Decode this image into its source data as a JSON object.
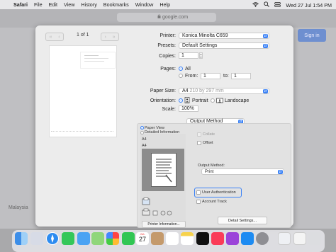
{
  "menubar": {
    "items": [
      "Safari",
      "File",
      "Edit",
      "View",
      "History",
      "Bookmarks",
      "Window",
      "Help"
    ],
    "datetime": "Wed 27 Jul  1:54 PM"
  },
  "browser": {
    "url": "google.com",
    "sign_in": "Sign in",
    "footer_country": "Malaysia"
  },
  "preview": {
    "page_count": "1 of 1"
  },
  "print": {
    "printer_label": "Printer:",
    "printer_value": "Konica Minolta C659",
    "presets_label": "Presets:",
    "presets_value": "Default Settings",
    "copies_label": "Copies:",
    "copies_value": "1",
    "pages_label": "Pages:",
    "pages_all": "All",
    "pages_from": "From:",
    "from_value": "1",
    "pages_to": "to:",
    "to_value": "1",
    "paper_size_label": "Paper Size:",
    "paper_size_value": "A4",
    "paper_size_dim": "210 by 297 mm",
    "orientation_label": "Orientation:",
    "orientation_portrait": "Portrait",
    "orientation_landscape": "Landscape",
    "scale_label": "Scale:",
    "scale_value": "100%",
    "section_value": "Output Method"
  },
  "output": {
    "paper_view": "Paper View",
    "detailed_info": "Detailed Information",
    "a4_1": "A4",
    "a4_2": "A4",
    "collate": "Collate",
    "offset": "Offset",
    "output_method_label": "Output Method:",
    "output_method_value": "Print",
    "user_auth": "User Authentication",
    "account_track": "Account Track",
    "printer_info_button": "Printer Information...",
    "detail_settings_button": "Detail Settings..."
  },
  "dock": {
    "calendar_month": "JUL",
    "calendar_day": "27",
    "icons": [
      "finder-icon",
      "launchpad-icon",
      "safari-icon",
      "messages-icon",
      "mail-icon",
      "maps-icon",
      "photos-icon",
      "facetime-icon",
      "calendar-icon",
      "contacts-icon",
      "reminders-icon",
      "notes-icon",
      "tv-icon",
      "music-icon",
      "podcasts-icon",
      "appstore-icon",
      "settings-icon",
      "preview-icon",
      "trash-icon"
    ]
  },
  "colors": {
    "accent": "#3b82f6",
    "sign_in": "#6e8fd0"
  }
}
